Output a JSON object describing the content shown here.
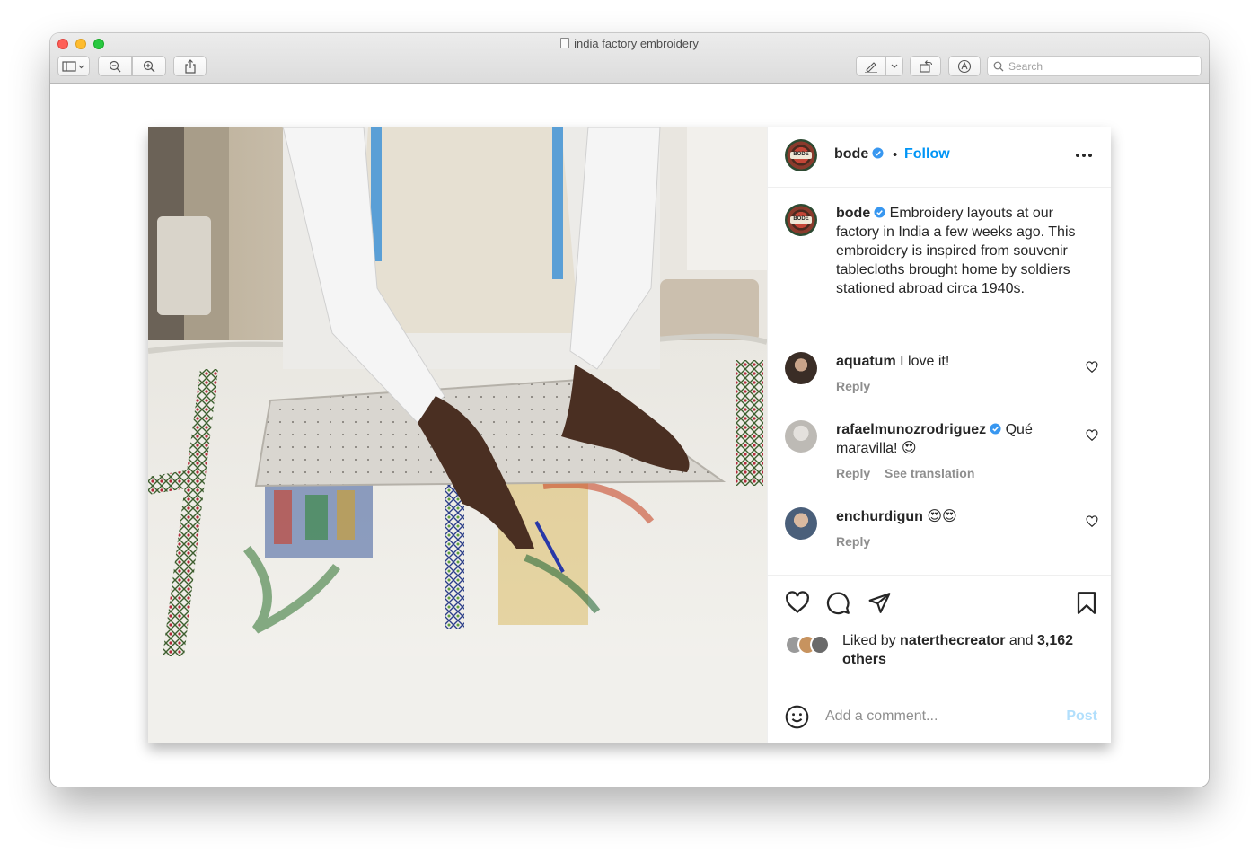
{
  "window": {
    "title": "india factory embroidery",
    "search_placeholder": "Search"
  },
  "post": {
    "header": {
      "username": "bode",
      "separator": "•",
      "follow_label": "Follow",
      "avatar_text": "BODE"
    },
    "caption": {
      "username": "bode",
      "text": "Embroidery layouts at our factory in India a few weeks ago. This embroidery is inspired from souvenir tablecloths brought home by soldiers stationed abroad circa 1940s."
    },
    "comments": [
      {
        "username": "aquatum",
        "text": "I love it!",
        "reply_label": "Reply",
        "verified": false
      },
      {
        "username": "rafaelmunozrodriguez",
        "text": "Qué maravilla! 😍",
        "reply_label": "Reply",
        "translation_label": "See translation",
        "verified": true
      },
      {
        "username": "enchurdigun",
        "text": "😍😍",
        "reply_label": "Reply",
        "verified": false
      }
    ],
    "likes": {
      "prefix": "Liked by",
      "user": "naterthecreator",
      "connector": "and",
      "count": "3,162",
      "suffix": "others"
    },
    "add_comment": {
      "placeholder": "Add a comment...",
      "post_label": "Post"
    }
  },
  "colors": {
    "link_blue": "#0095f6",
    "post_disabled": "#b2dffc",
    "text": "#262626",
    "muted": "#8e8e8e",
    "verified": "#3897f0"
  }
}
